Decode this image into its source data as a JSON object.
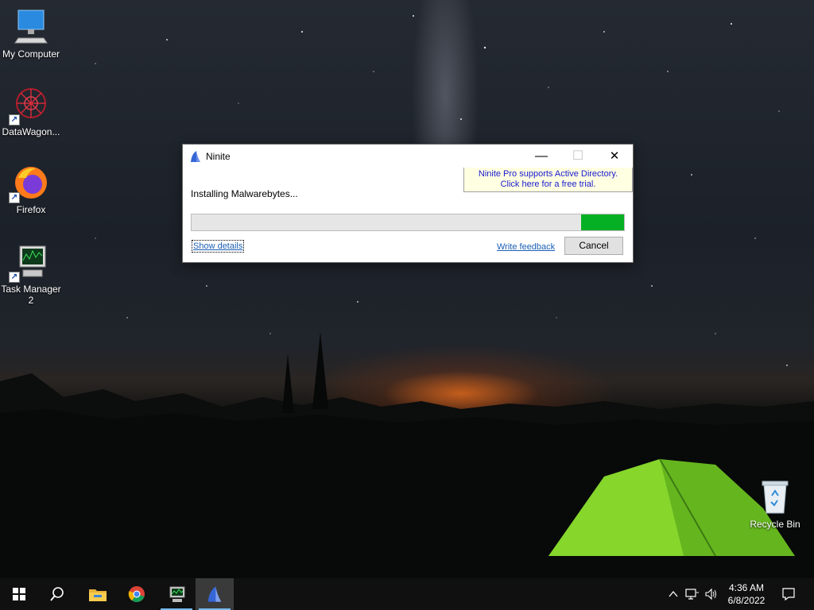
{
  "desktop": {
    "icons": [
      {
        "label": "My Computer"
      },
      {
        "label": "DataWagon..."
      },
      {
        "label": "Firefox"
      },
      {
        "label": "Task Manager 2"
      },
      {
        "label": "Recycle Bin"
      }
    ]
  },
  "window": {
    "title": "Ninite",
    "promo_line1": "Ninite Pro supports Active Directory.",
    "promo_line2": "Click here for a free trial.",
    "status": "Installing Malwarebytes...",
    "progress_fraction": 0.1,
    "progress_state": "indeterminate",
    "show_details": "Show details",
    "write_feedback": "Write feedback",
    "cancel": "Cancel",
    "minimize_glyph": "—",
    "maximize_glyph": "☐",
    "close_glyph": "✕"
  },
  "taskbar": {
    "pinned": [
      "start-icon",
      "search-icon",
      "file-explorer-icon",
      "chrome-icon",
      "task-manager-icon",
      "ninite-icon"
    ],
    "time": "4:36 AM",
    "date": "6/8/2022"
  },
  "colors": {
    "progress": "#06b025",
    "link": "#1a5fb4",
    "promo_bg": "#ffffe1",
    "taskbar": "#101010",
    "accent": "#76b9ed"
  }
}
